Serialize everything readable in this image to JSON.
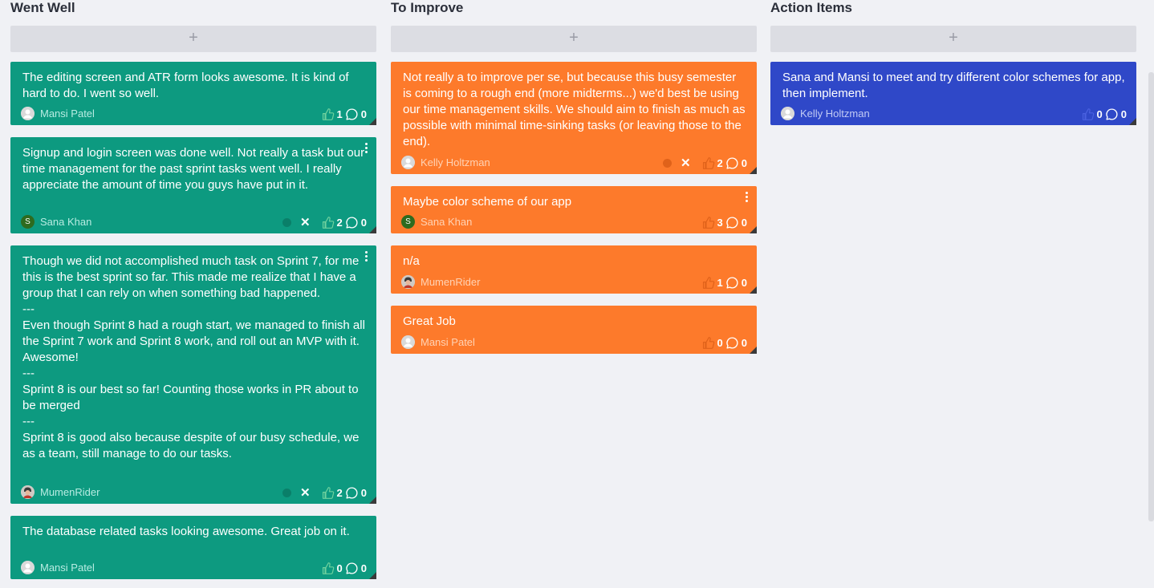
{
  "columns": [
    {
      "title": "Went Well",
      "add_label": "+",
      "color": "#0d9a80",
      "author_color": "#b8ece2",
      "thumb_color": "#6fd19e",
      "cards": [
        {
          "text": "The editing screen and ATR form looks awesome. It is kind of hard to do. I went so well.",
          "author": "Mansi Patel",
          "avatar": "person-icon",
          "likes": "1",
          "comments": "0",
          "menu": false,
          "status": false
        },
        {
          "text": "Signup and login screen was done well. Not really a task but our time management for the past sprint tasks went well. I really appreciate the amount of time you guys have put in it.",
          "author": "Sana Khan",
          "avatar": "S",
          "likes": "2",
          "comments": "0",
          "menu": true,
          "status": true
        },
        {
          "text": "Though we did not accomplished much task on Sprint 7, for me this is the best sprint so far. This made me realize that I have a group that I can rely on when something bad happened.\n---\nEven though Sprint 8 had a rough start, we managed to finish all the Sprint 7 work and Sprint 8 work, and roll out an MVP with it. Awesome!\n---\nSprint 8 is our best so far! Counting those works in PR about to be merged\n---\nSprint 8 is good also because despite of our busy schedule, we as a team, still manage to do our tasks.",
          "author": "MumenRider",
          "avatar": "photo-avatar-icon",
          "likes": "2",
          "comments": "0",
          "menu": true,
          "status": true
        },
        {
          "text": "The database related tasks looking awesome. Great job on it.",
          "author": "Mansi Patel",
          "avatar": "person-icon",
          "likes": "0",
          "comments": "0",
          "menu": false,
          "status": false
        }
      ]
    },
    {
      "title": "To Improve",
      "add_label": "+",
      "color": "#fd7a2b",
      "author_color": "#ffd3b5",
      "thumb_color": "#e0621a",
      "cards": [
        {
          "text": "Not really a to improve per se, but because this busy semester is coming to a rough end (more midterms...) we'd best be using our time management skills. We should aim to finish as much as possible with minimal time-sinking tasks (or leaving those to the end).",
          "author": "Kelly Holtzman",
          "avatar": "person-icon",
          "likes": "2",
          "comments": "0",
          "menu": false,
          "status": true
        },
        {
          "text": "Maybe color scheme of our app",
          "author": "Sana Khan",
          "avatar": "S",
          "likes": "3",
          "comments": "0",
          "menu": true,
          "status": false
        },
        {
          "text": "n/a",
          "author": "MumenRider",
          "avatar": "photo-avatar-icon",
          "likes": "1",
          "comments": "0",
          "menu": false,
          "status": false
        },
        {
          "text": "Great Job",
          "author": "Mansi Patel",
          "avatar": "person-icon",
          "likes": "0",
          "comments": "0",
          "menu": false,
          "status": false
        }
      ]
    },
    {
      "title": "Action Items",
      "add_label": "+",
      "color": "#2f48c8",
      "author_color": "#c2cbf5",
      "thumb_color": "#4a61e0",
      "cards": [
        {
          "text": "Sana and Mansi to meet and try different color schemes for app, then implement.",
          "author": "Kelly Holtzman",
          "avatar": "person-icon",
          "likes": "0",
          "comments": "0",
          "menu": false,
          "status": false
        }
      ]
    }
  ],
  "icons": {
    "like": "thumbs-up-icon",
    "comment": "comment-icon",
    "menu": "kebab-menu-icon",
    "remove": "close-icon",
    "status": "status-dot-icon"
  }
}
